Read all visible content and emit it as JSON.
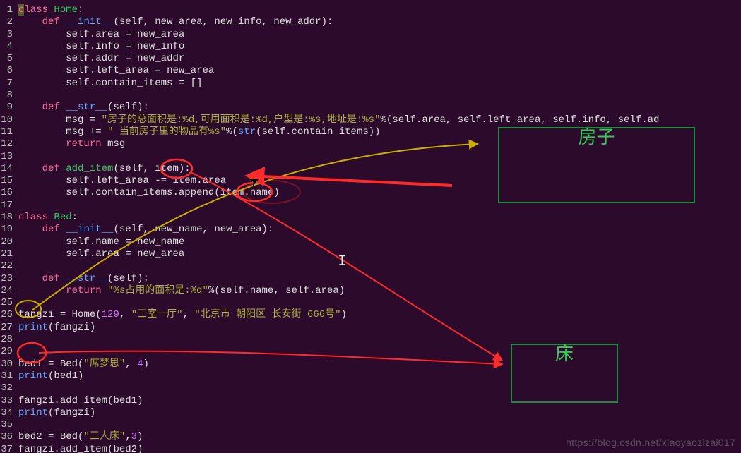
{
  "watermark": "https://blog.csdn.net/xiaoyaozizai017",
  "annotations": {
    "house": "房子",
    "bed": "床"
  },
  "caret_col": 0,
  "caret_line": 1,
  "code_lines": [
    {
      "n": 1,
      "t": [
        [
          "kw",
          "class"
        ],
        [
          "sp",
          " "
        ],
        [
          "class",
          "Home"
        ],
        [
          "punc",
          ":"
        ]
      ]
    },
    {
      "n": 2,
      "t": [
        [
          "sp",
          "    "
        ],
        [
          "kw",
          "def"
        ],
        [
          "sp",
          " "
        ],
        [
          "dunder",
          "__init__"
        ],
        [
          "punc",
          "("
        ],
        [
          "ident",
          "self"
        ],
        [
          "punc",
          ", "
        ],
        [
          "ident",
          "new_area"
        ],
        [
          "punc",
          ", "
        ],
        [
          "ident",
          "new_info"
        ],
        [
          "punc",
          ", "
        ],
        [
          "ident",
          "new_addr"
        ],
        [
          "punc",
          "):"
        ]
      ]
    },
    {
      "n": 3,
      "t": [
        [
          "sp",
          "        "
        ],
        [
          "ident",
          "self"
        ],
        [
          "punc",
          "."
        ],
        [
          "ident",
          "area"
        ],
        [
          "sp",
          " "
        ],
        [
          "op",
          "="
        ],
        [
          "sp",
          " "
        ],
        [
          "ident",
          "new_area"
        ]
      ]
    },
    {
      "n": 4,
      "t": [
        [
          "sp",
          "        "
        ],
        [
          "ident",
          "self"
        ],
        [
          "punc",
          "."
        ],
        [
          "ident",
          "info"
        ],
        [
          "sp",
          " "
        ],
        [
          "op",
          "="
        ],
        [
          "sp",
          " "
        ],
        [
          "ident",
          "new_info"
        ]
      ]
    },
    {
      "n": 5,
      "t": [
        [
          "sp",
          "        "
        ],
        [
          "ident",
          "self"
        ],
        [
          "punc",
          "."
        ],
        [
          "ident",
          "addr"
        ],
        [
          "sp",
          " "
        ],
        [
          "op",
          "="
        ],
        [
          "sp",
          " "
        ],
        [
          "ident",
          "new_addr"
        ]
      ]
    },
    {
      "n": 6,
      "t": [
        [
          "sp",
          "        "
        ],
        [
          "ident",
          "self"
        ],
        [
          "punc",
          "."
        ],
        [
          "ident",
          "left_area"
        ],
        [
          "sp",
          " "
        ],
        [
          "op",
          "="
        ],
        [
          "sp",
          " "
        ],
        [
          "ident",
          "new_area"
        ]
      ]
    },
    {
      "n": 7,
      "t": [
        [
          "sp",
          "        "
        ],
        [
          "ident",
          "self"
        ],
        [
          "punc",
          "."
        ],
        [
          "ident",
          "contain_items"
        ],
        [
          "sp",
          " "
        ],
        [
          "op",
          "="
        ],
        [
          "sp",
          " "
        ],
        [
          "punc",
          "[]"
        ]
      ]
    },
    {
      "n": 8,
      "t": [
        [
          "sp",
          ""
        ]
      ]
    },
    {
      "n": 9,
      "t": [
        [
          "sp",
          "    "
        ],
        [
          "kw",
          "def"
        ],
        [
          "sp",
          " "
        ],
        [
          "dunder",
          "__str__"
        ],
        [
          "punc",
          "("
        ],
        [
          "ident",
          "self"
        ],
        [
          "punc",
          "):"
        ]
      ]
    },
    {
      "n": 10,
      "t": [
        [
          "sp",
          "        "
        ],
        [
          "ident",
          "msg"
        ],
        [
          "sp",
          " "
        ],
        [
          "op",
          "="
        ],
        [
          "sp",
          " "
        ],
        [
          "str",
          "\"房子的总面积是:%d,可用面积是:%d,户型是:%s,地址是:%s\""
        ],
        [
          "op",
          "%"
        ],
        [
          "punc",
          "("
        ],
        [
          "ident",
          "self"
        ],
        [
          "punc",
          "."
        ],
        [
          "ident",
          "area"
        ],
        [
          "punc",
          ", "
        ],
        [
          "ident",
          "self"
        ],
        [
          "punc",
          "."
        ],
        [
          "ident",
          "left_area"
        ],
        [
          "punc",
          ", "
        ],
        [
          "ident",
          "self"
        ],
        [
          "punc",
          "."
        ],
        [
          "ident",
          "info"
        ],
        [
          "punc",
          ", "
        ],
        [
          "ident",
          "self"
        ],
        [
          "punc",
          "."
        ],
        [
          "ident",
          "ad"
        ]
      ]
    },
    {
      "n": 11,
      "t": [
        [
          "sp",
          "        "
        ],
        [
          "ident",
          "msg"
        ],
        [
          "sp",
          " "
        ],
        [
          "op",
          "+="
        ],
        [
          "sp",
          " "
        ],
        [
          "str",
          "\" 当前房子里的物品有%s\""
        ],
        [
          "op",
          "%"
        ],
        [
          "punc",
          "("
        ],
        [
          "builtin",
          "str"
        ],
        [
          "punc",
          "("
        ],
        [
          "ident",
          "self"
        ],
        [
          "punc",
          "."
        ],
        [
          "ident",
          "contain_items"
        ],
        [
          "punc",
          "))"
        ]
      ]
    },
    {
      "n": 12,
      "t": [
        [
          "sp",
          "        "
        ],
        [
          "return",
          "return"
        ],
        [
          "sp",
          " "
        ],
        [
          "ident",
          "msg"
        ]
      ]
    },
    {
      "n": 13,
      "t": [
        [
          "sp",
          ""
        ]
      ]
    },
    {
      "n": 14,
      "t": [
        [
          "sp",
          "    "
        ],
        [
          "kw",
          "def"
        ],
        [
          "sp",
          " "
        ],
        [
          "fn",
          "add_item"
        ],
        [
          "punc",
          "("
        ],
        [
          "ident",
          "self"
        ],
        [
          "punc",
          ", "
        ],
        [
          "ident",
          "item"
        ],
        [
          "punc",
          "):"
        ]
      ]
    },
    {
      "n": 15,
      "t": [
        [
          "sp",
          "        "
        ],
        [
          "ident",
          "self"
        ],
        [
          "punc",
          "."
        ],
        [
          "ident",
          "left_area"
        ],
        [
          "sp",
          " "
        ],
        [
          "op",
          "-="
        ],
        [
          "sp",
          " "
        ],
        [
          "ident",
          "item"
        ],
        [
          "punc",
          "."
        ],
        [
          "ident",
          "area"
        ]
      ]
    },
    {
      "n": 16,
      "t": [
        [
          "sp",
          "        "
        ],
        [
          "ident",
          "self"
        ],
        [
          "punc",
          "."
        ],
        [
          "ident",
          "contain_items"
        ],
        [
          "punc",
          "."
        ],
        [
          "ident",
          "append"
        ],
        [
          "punc",
          "("
        ],
        [
          "ident",
          "item"
        ],
        [
          "punc",
          "."
        ],
        [
          "ident",
          "name"
        ],
        [
          "punc",
          ")"
        ]
      ]
    },
    {
      "n": 17,
      "t": [
        [
          "sp",
          ""
        ]
      ]
    },
    {
      "n": 18,
      "t": [
        [
          "kw",
          "class"
        ],
        [
          "sp",
          " "
        ],
        [
          "class",
          "Bed"
        ],
        [
          "punc",
          ":"
        ]
      ]
    },
    {
      "n": 19,
      "t": [
        [
          "sp",
          "    "
        ],
        [
          "kw",
          "def"
        ],
        [
          "sp",
          " "
        ],
        [
          "dunder",
          "__init__"
        ],
        [
          "punc",
          "("
        ],
        [
          "ident",
          "self"
        ],
        [
          "punc",
          ", "
        ],
        [
          "ident",
          "new_name"
        ],
        [
          "punc",
          ", "
        ],
        [
          "ident",
          "new_area"
        ],
        [
          "punc",
          "):"
        ]
      ]
    },
    {
      "n": 20,
      "t": [
        [
          "sp",
          "        "
        ],
        [
          "ident",
          "self"
        ],
        [
          "punc",
          "."
        ],
        [
          "ident",
          "name"
        ],
        [
          "sp",
          " "
        ],
        [
          "op",
          "="
        ],
        [
          "sp",
          " "
        ],
        [
          "ident",
          "new_name"
        ]
      ]
    },
    {
      "n": 21,
      "t": [
        [
          "sp",
          "        "
        ],
        [
          "ident",
          "self"
        ],
        [
          "punc",
          "."
        ],
        [
          "ident",
          "area"
        ],
        [
          "sp",
          " "
        ],
        [
          "op",
          "="
        ],
        [
          "sp",
          " "
        ],
        [
          "ident",
          "new_area"
        ]
      ]
    },
    {
      "n": 22,
      "t": [
        [
          "sp",
          ""
        ]
      ]
    },
    {
      "n": 23,
      "t": [
        [
          "sp",
          "    "
        ],
        [
          "kw",
          "def"
        ],
        [
          "sp",
          " "
        ],
        [
          "dunder",
          "__str__"
        ],
        [
          "punc",
          "("
        ],
        [
          "ident",
          "self"
        ],
        [
          "punc",
          "):"
        ]
      ]
    },
    {
      "n": 24,
      "t": [
        [
          "sp",
          "        "
        ],
        [
          "return",
          "return"
        ],
        [
          "sp",
          " "
        ],
        [
          "str",
          "\"%s占用的面积是:%d\""
        ],
        [
          "op",
          "%"
        ],
        [
          "punc",
          "("
        ],
        [
          "ident",
          "self"
        ],
        [
          "punc",
          "."
        ],
        [
          "ident",
          "name"
        ],
        [
          "punc",
          ", "
        ],
        [
          "ident",
          "self"
        ],
        [
          "punc",
          "."
        ],
        [
          "ident",
          "area"
        ],
        [
          "punc",
          ")"
        ]
      ]
    },
    {
      "n": 25,
      "t": [
        [
          "sp",
          ""
        ]
      ]
    },
    {
      "n": 26,
      "t": [
        [
          "ident",
          "fangzi"
        ],
        [
          "sp",
          " "
        ],
        [
          "op",
          "="
        ],
        [
          "sp",
          " "
        ],
        [
          "ident",
          "Home"
        ],
        [
          "punc",
          "("
        ],
        [
          "num",
          "129"
        ],
        [
          "punc",
          ", "
        ],
        [
          "str",
          "\"三室一厅\""
        ],
        [
          "punc",
          ", "
        ],
        [
          "str",
          "\"北京市 朝阳区 长安街 666号\""
        ],
        [
          "punc",
          ")"
        ]
      ]
    },
    {
      "n": 27,
      "t": [
        [
          "builtin",
          "print"
        ],
        [
          "punc",
          "("
        ],
        [
          "ident",
          "fangzi"
        ],
        [
          "punc",
          ")"
        ]
      ]
    },
    {
      "n": 28,
      "t": [
        [
          "sp",
          ""
        ]
      ]
    },
    {
      "n": 29,
      "t": [
        [
          "sp",
          ""
        ]
      ]
    },
    {
      "n": 30,
      "t": [
        [
          "ident",
          "bed1"
        ],
        [
          "sp",
          " "
        ],
        [
          "op",
          "="
        ],
        [
          "sp",
          " "
        ],
        [
          "ident",
          "Bed"
        ],
        [
          "punc",
          "("
        ],
        [
          "str",
          "\"席梦思\""
        ],
        [
          "punc",
          ", "
        ],
        [
          "num",
          "4"
        ],
        [
          "punc",
          ")"
        ]
      ]
    },
    {
      "n": 31,
      "t": [
        [
          "builtin",
          "print"
        ],
        [
          "punc",
          "("
        ],
        [
          "ident",
          "bed1"
        ],
        [
          "punc",
          ")"
        ]
      ]
    },
    {
      "n": 32,
      "t": [
        [
          "sp",
          ""
        ]
      ]
    },
    {
      "n": 33,
      "t": [
        [
          "ident",
          "fangzi"
        ],
        [
          "punc",
          "."
        ],
        [
          "ident",
          "add_item"
        ],
        [
          "punc",
          "("
        ],
        [
          "ident",
          "bed1"
        ],
        [
          "punc",
          ")"
        ]
      ]
    },
    {
      "n": 34,
      "t": [
        [
          "builtin",
          "print"
        ],
        [
          "punc",
          "("
        ],
        [
          "ident",
          "fangzi"
        ],
        [
          "punc",
          ")"
        ]
      ]
    },
    {
      "n": 35,
      "t": [
        [
          "sp",
          ""
        ]
      ]
    },
    {
      "n": 36,
      "t": [
        [
          "ident",
          "bed2"
        ],
        [
          "sp",
          " "
        ],
        [
          "op",
          "="
        ],
        [
          "sp",
          " "
        ],
        [
          "ident",
          "Bed"
        ],
        [
          "punc",
          "("
        ],
        [
          "str",
          "\"三人床\""
        ],
        [
          "punc",
          ","
        ],
        [
          "num",
          "3"
        ],
        [
          "punc",
          ")"
        ]
      ]
    },
    {
      "n": 37,
      "t": [
        [
          "ident",
          "fangzi"
        ],
        [
          "punc",
          "."
        ],
        [
          "ident",
          "add_item"
        ],
        [
          "punc",
          "("
        ],
        [
          "ident",
          "bed2"
        ],
        [
          "punc",
          ")"
        ]
      ]
    }
  ]
}
